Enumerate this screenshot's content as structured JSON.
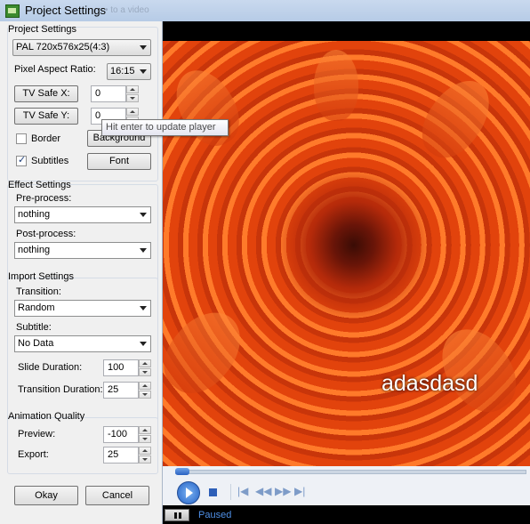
{
  "window": {
    "title": "Project Settings",
    "ghost_text": "• to a video"
  },
  "project_settings": {
    "label": "Project Settings",
    "format": "PAL 720x576x25(4:3)",
    "pixel_aspect_label": "Pixel Aspect Ratio:",
    "pixel_aspect_value": "16:15",
    "tv_safe_x_label": "TV Safe X:",
    "tv_safe_x_value": "0",
    "tv_safe_y_label": "TV Safe Y:",
    "tv_safe_y_value": "0",
    "border_label": "Border",
    "border_checked": false,
    "background_label": "Background",
    "subtitles_label": "Subtitles",
    "subtitles_checked": true,
    "font_label": "Font"
  },
  "tooltip": "Hit enter to update player",
  "effect_settings": {
    "label": "Effect Settings",
    "pre_label": "Pre-process:",
    "pre_value": "nothing",
    "post_label": "Post-process:",
    "post_value": "nothing"
  },
  "import_settings": {
    "label": "Import Settings",
    "transition_label": "Transition:",
    "transition_value": "Random",
    "subtitle_label": "Subtitle:",
    "subtitle_value": "No Data",
    "slide_duration_label": "Slide Duration:",
    "slide_duration_value": "100",
    "transition_duration_label": "Transition Duration:",
    "transition_duration_value": "25"
  },
  "animation_quality": {
    "label": "Animation Quality",
    "preview_label": "Preview:",
    "preview_value": "-100",
    "export_label": "Export:",
    "export_value": "25"
  },
  "buttons": {
    "okay": "Okay",
    "cancel": "Cancel"
  },
  "player": {
    "caption": "adasdasd",
    "status": "Paused",
    "icons": [
      "play-icon",
      "stop-icon",
      "skip-back-icon",
      "rewind-icon",
      "fast-forward-icon",
      "skip-forward-icon",
      "pause-icon"
    ],
    "accent": "#2a62c2"
  }
}
